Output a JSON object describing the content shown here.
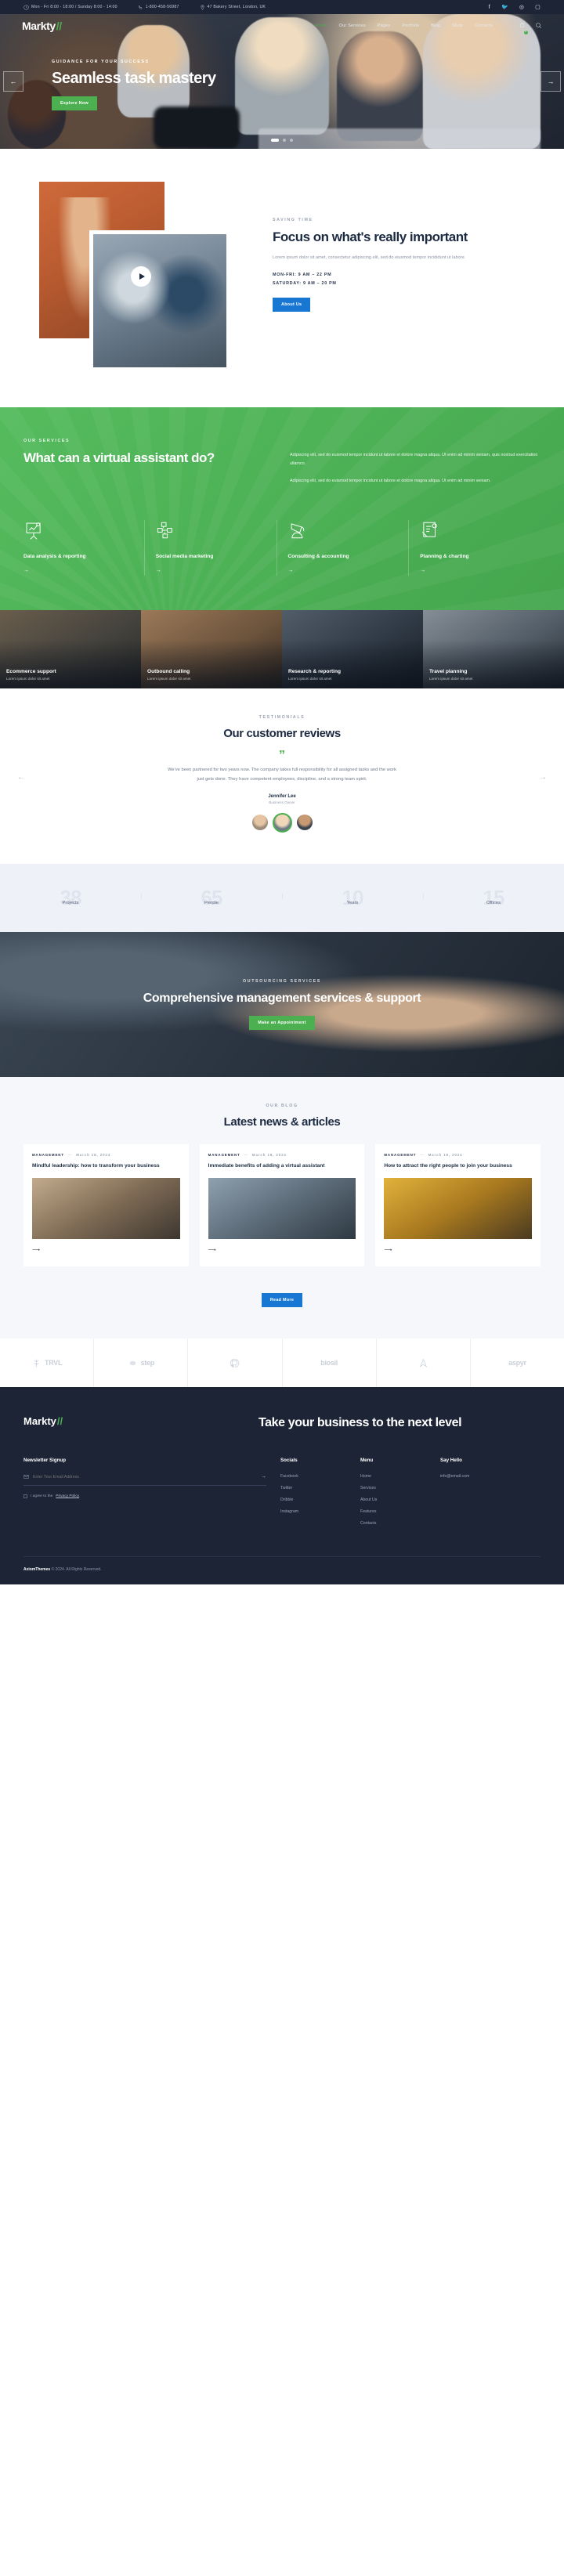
{
  "topbar": {
    "hours": "Mon - Fri 8:00 - 18:00 / Sunday 8:00 - 14:00",
    "phone": "1-800-458-56987",
    "address": "47 Bakery Street, London, UK",
    "socials": [
      "facebook-icon",
      "twitter-icon",
      "dribbble-icon",
      "instagram-icon"
    ]
  },
  "nav": {
    "logo": "Markty",
    "logo_slash": "//",
    "items": [
      {
        "label": "Home",
        "active": true
      },
      {
        "label": "Our Services",
        "active": false
      },
      {
        "label": "Pages",
        "active": false
      },
      {
        "label": "Portfolio",
        "active": false
      },
      {
        "label": "Blog",
        "active": false
      },
      {
        "label": "Shop",
        "active": false
      },
      {
        "label": "Contacts",
        "active": false
      }
    ],
    "cart_count": "0"
  },
  "hero": {
    "kicker": "GUIDANCE FOR YOUR SUCCESS",
    "title": "Seamless task mastery",
    "button": "Explore Now",
    "prev": "←",
    "next": "→"
  },
  "focus": {
    "kicker": "SAVING TIME",
    "title": "Focus on what's really important",
    "lead": "Lorem ipsum dolor sit amet, consectetur adipiscing elit, sed do eiusmod tempor incididunt ut labore.",
    "hours_weekday": "MON-FRI: 9 AM – 22 PM",
    "hours_saturday": "SATURDAY: 9 AM – 20 PM",
    "button": "About Us"
  },
  "services": {
    "kicker": "OUR SERVICES",
    "title": "What can a virtual assistant do?",
    "para1": "Adipiscing elit, sed do euismod tempor incidunt ut labore et dolore magna aliqua. Ut enim ad minim veniam, quis nostrud exercitation ullamco.",
    "para2": "Adipiscing elit, sed do euismod tempor incidunt ut labore et dolore magna aliqua. Ut enim ad minim veniam.",
    "cards": [
      {
        "icon": "chart-board-icon",
        "title": "Data analysis & reporting",
        "arrow": "→"
      },
      {
        "icon": "network-nodes-icon",
        "title": "Social media marketing",
        "arrow": "→"
      },
      {
        "icon": "megaphone-icon",
        "title": "Consulting & accounting",
        "arrow": "→"
      },
      {
        "icon": "clipboard-money-icon",
        "title": "Planning & charting",
        "arrow": "→"
      }
    ]
  },
  "tiles": [
    {
      "title": "Ecommerce support",
      "text": "Lorem ipsum dolor sit amet"
    },
    {
      "title": "Outbound calling",
      "text": "Lorem ipsum dolor sit amet"
    },
    {
      "title": "Research & reporting",
      "text": "Lorem ipsum dolor sit amet"
    },
    {
      "title": "Travel planning",
      "text": "Lorem ipsum dolor sit amet"
    }
  ],
  "testimonials": {
    "kicker": "TESTIMONIALS",
    "title": "Our customer reviews",
    "quote_mark": "”",
    "body": "We've been partnered for two years now. The company takes full responsibility for all assigned tasks and the work just gets done. They have competent employees, discipline, and a strong team spirit.",
    "name": "Jennifer Lee",
    "role": "Business Owner",
    "prev": "←",
    "next": "→"
  },
  "stats": [
    {
      "number": "38",
      "label": "Projects"
    },
    {
      "number": "65",
      "label": "People"
    },
    {
      "number": "10",
      "label": "Years"
    },
    {
      "number": "15",
      "label": "Offices"
    }
  ],
  "cta": {
    "kicker": "OUTSOURCING SERVICES",
    "title": "Comprehensive management services & support",
    "button": "Make an Appointment"
  },
  "blog": {
    "kicker": "OUR BLOG",
    "title": "Latest news & articles",
    "posts": [
      {
        "category": "MANAGEMENT",
        "date": "March 18, 2024",
        "title": "Mindful leadership: how to transform your business",
        "arrow": "⟶"
      },
      {
        "category": "MANAGEMENT",
        "date": "March 18, 2024",
        "title": "Immediate benefits of adding a virtual assistant",
        "arrow": "⟶"
      },
      {
        "category": "MANAGEMENT",
        "date": "March 18, 2024",
        "title": "How to attract the right people to join your business",
        "arrow": "⟶"
      }
    ],
    "button": "Read More"
  },
  "brands": [
    {
      "name": "TRVL",
      "icon": "leaf-icon"
    },
    {
      "name": "step",
      "icon": "blob-icon"
    },
    {
      "name": "",
      "icon": "github-icon"
    },
    {
      "name": "biosil",
      "icon": ""
    },
    {
      "name": "",
      "icon": "compass-icon"
    },
    {
      "name": "aspyr",
      "icon": ""
    }
  ],
  "footer": {
    "logo": "Markty",
    "logo_slash": "//",
    "headline": "Take your business to the next level",
    "newsletter_title": "Newsletter Signup",
    "email_placeholder": "Enter Your Email Address",
    "submit_arrow": "→",
    "consent_pre": "I agree to the",
    "consent_link": "Privacy Policy",
    "columns": [
      {
        "title": "Socials",
        "links": [
          "Facebook",
          "Twitter",
          "Dribble",
          "Instagram"
        ]
      },
      {
        "title": "Menu",
        "links": [
          "Home",
          "Services",
          "About Us",
          "Features",
          "Contacts"
        ]
      },
      {
        "title": "Say Hello",
        "links": [
          "info@email.com"
        ]
      }
    ],
    "copyright_brand": "AxiomThemes",
    "copyright_rest": "© 2024. All Rights Reserved."
  },
  "colors": {
    "green": "#4caf50",
    "blue": "#1877d2",
    "dark": "#1d2436"
  }
}
